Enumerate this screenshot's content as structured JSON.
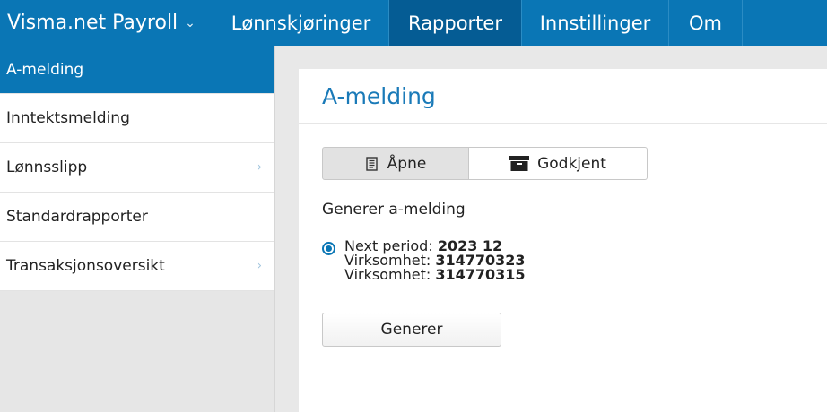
{
  "header": {
    "brand": "Visma.net Payroll",
    "nav": [
      {
        "label": "Lønnskjøringer"
      },
      {
        "label": "Rapporter"
      },
      {
        "label": "Innstillinger"
      },
      {
        "label": "Om"
      }
    ],
    "active_nav": "Rapporter"
  },
  "sidebar": {
    "items": [
      {
        "label": "A-melding"
      },
      {
        "label": "Inntektsmelding"
      },
      {
        "label": "Lønnsslipp"
      },
      {
        "label": "Standardrapporter"
      },
      {
        "label": "Transaksjonsoversikt"
      }
    ]
  },
  "main": {
    "title": "A-melding",
    "tabs": [
      {
        "label": "Åpne",
        "icon": "document-icon",
        "selected": true
      },
      {
        "label": "Godkjent",
        "icon": "archive-icon",
        "selected": false
      }
    ],
    "subheading": "Generer a-melding",
    "option": {
      "line1_label": "Next period:",
      "line1_value": "2023 12",
      "line2_label": "Virksomhet:",
      "line2_value": "314770323",
      "line3_label": "Virksomhet:",
      "line3_value": "314770315",
      "selected": true
    },
    "generate_button": "Generer"
  },
  "colors": {
    "primary": "#0a76b5",
    "primary_dark": "#055c94",
    "title_blue": "#1a7ab8"
  }
}
